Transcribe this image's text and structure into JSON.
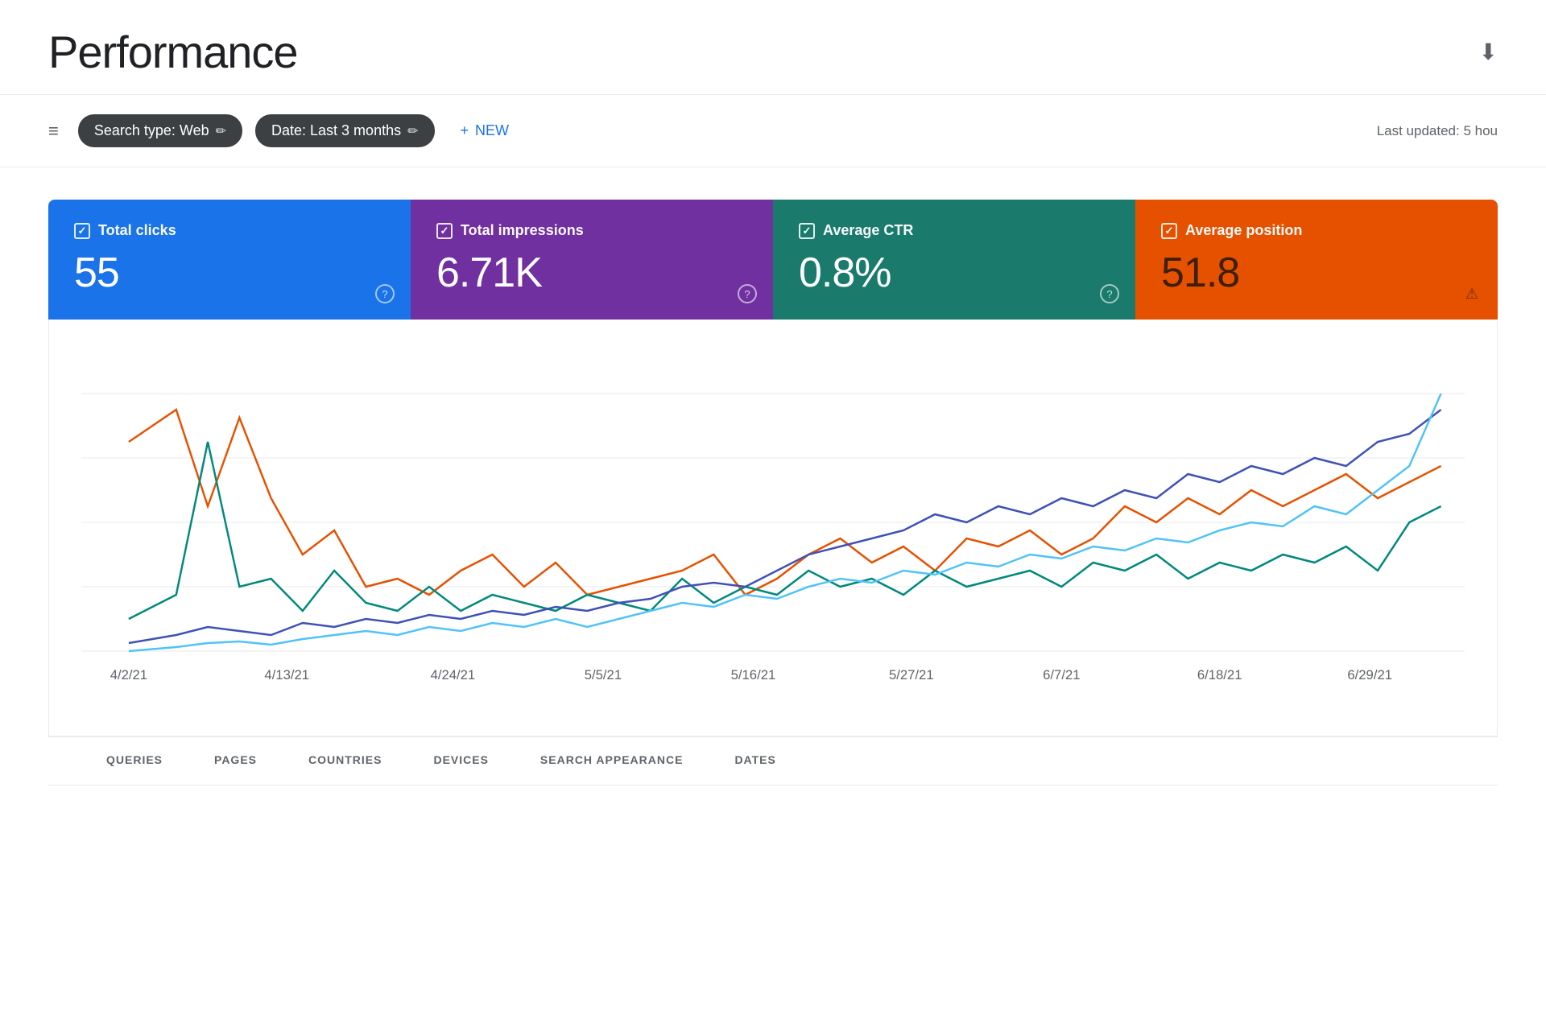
{
  "header": {
    "title": "Performance",
    "download_icon": "⬇"
  },
  "toolbar": {
    "filter_icon": "≡",
    "chips": [
      {
        "label": "Search type: Web",
        "edit": "✏"
      },
      {
        "label": "Date: Last 3 months",
        "edit": "✏"
      }
    ],
    "new_button_icon": "+",
    "new_button_label": "NEW",
    "last_updated_label": "Last updated: 5 hou"
  },
  "metrics": [
    {
      "id": "total-clicks",
      "label": "Total clicks",
      "value": "55",
      "color": "blue",
      "help": "?"
    },
    {
      "id": "total-impressions",
      "label": "Total impressions",
      "value": "6.71K",
      "color": "purple",
      "help": "?"
    },
    {
      "id": "average-ctr",
      "label": "Average CTR",
      "value": "0.8%",
      "color": "teal",
      "help": "?"
    },
    {
      "id": "average-position",
      "label": "Average position",
      "value": "51.8",
      "color": "orange",
      "warn": "⚠"
    }
  ],
  "chart": {
    "x_labels": [
      "4/2/21",
      "4/13/21",
      "4/24/21",
      "5/5/21",
      "5/16/21",
      "5/27/21",
      "6/7/21",
      "6/18/21",
      "6/29/21"
    ],
    "lines": [
      {
        "color": "#1a73e8",
        "label": "Total clicks"
      },
      {
        "color": "#7b1fa2",
        "label": "Total impressions"
      },
      {
        "color": "#00897b",
        "label": "Average CTR"
      },
      {
        "color": "#e65100",
        "label": "Average position"
      }
    ]
  },
  "tabs": [
    {
      "label": "QUERIES"
    },
    {
      "label": "PAGES"
    },
    {
      "label": "COUNTRIES"
    },
    {
      "label": "DEVICES"
    },
    {
      "label": "SEARCH APPEARANCE"
    },
    {
      "label": "DATES"
    }
  ]
}
